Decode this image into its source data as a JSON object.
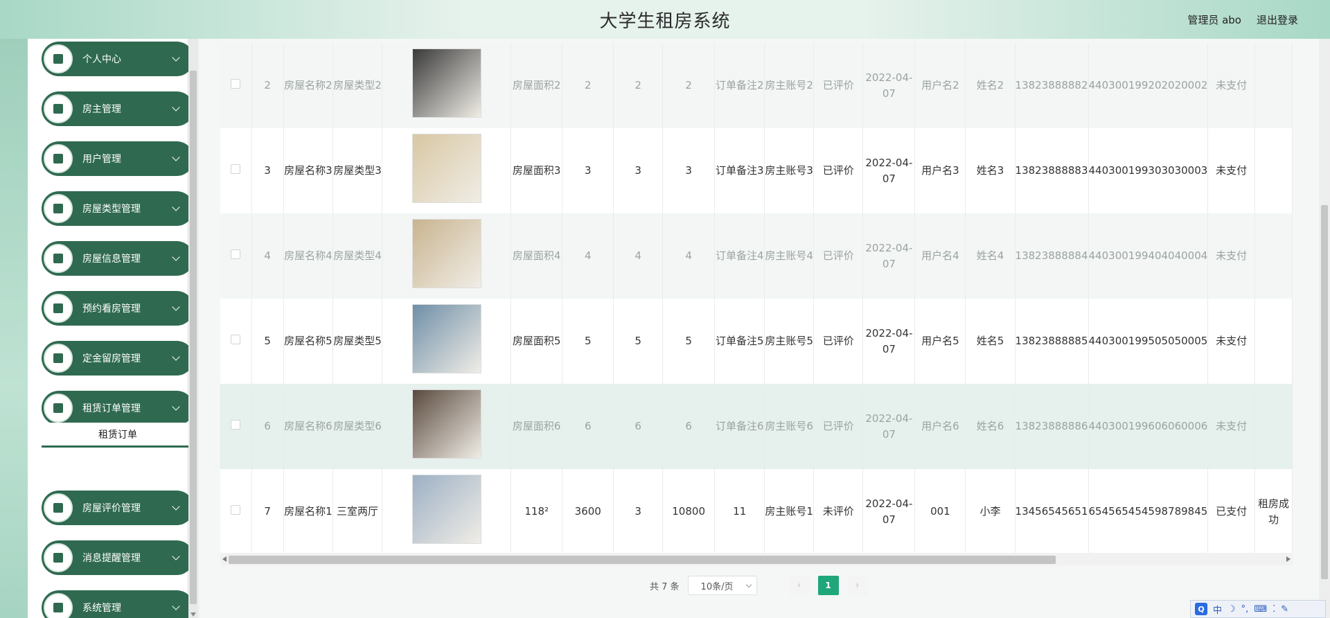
{
  "header": {
    "title": "大学生租房系统",
    "user_label": "管理员 abo",
    "logout_label": "退出登录"
  },
  "sidebar": {
    "items": [
      {
        "label": "个人中心",
        "icon": "user-icon"
      },
      {
        "label": "房主管理",
        "icon": "clipboard-icon"
      },
      {
        "label": "用户管理",
        "icon": "grid-icon"
      },
      {
        "label": "房屋类型管理",
        "icon": "list-icon"
      },
      {
        "label": "房屋信息管理",
        "icon": "briefcase-icon"
      },
      {
        "label": "预约看房管理",
        "icon": "grid-icon"
      },
      {
        "label": "定金留房管理",
        "icon": "clipboard-icon"
      },
      {
        "label": "租赁订单管理",
        "icon": "grid-icon"
      },
      {
        "label": "房屋评价管理",
        "icon": "grid-icon"
      },
      {
        "label": "消息提醒管理",
        "icon": "chat-icon"
      },
      {
        "label": "系统管理",
        "icon": "book-icon"
      }
    ],
    "submenu": {
      "label": "租赁订单"
    }
  },
  "table": {
    "rows": [
      {
        "idx": "2",
        "name": "房屋名称2",
        "type": "房屋类型2",
        "area": "房屋面积2",
        "c1": "2",
        "c2": "2",
        "c3": "2",
        "note": "订单备注2",
        "owner": "房主账号2",
        "review": "已评价",
        "date": "2022-04-07",
        "user": "用户名2",
        "realname": "姓名2",
        "phone": "13823888882",
        "idcard": "440300199202020002",
        "pay": "未支付",
        "extra": "",
        "img_color": "#3a3a3a"
      },
      {
        "idx": "3",
        "name": "房屋名称3",
        "type": "房屋类型3",
        "area": "房屋面积3",
        "c1": "3",
        "c2": "3",
        "c3": "3",
        "note": "订单备注3",
        "owner": "房主账号3",
        "review": "已评价",
        "date": "2022-04-07",
        "user": "用户名3",
        "realname": "姓名3",
        "phone": "13823888883",
        "idcard": "440300199303030003",
        "pay": "未支付",
        "extra": "",
        "img_color": "#d8c7a3"
      },
      {
        "idx": "4",
        "name": "房屋名称4",
        "type": "房屋类型4",
        "area": "房屋面积4",
        "c1": "4",
        "c2": "4",
        "c3": "4",
        "note": "订单备注4",
        "owner": "房主账号4",
        "review": "已评价",
        "date": "2022-04-07",
        "user": "用户名4",
        "realname": "姓名4",
        "phone": "13823888884",
        "idcard": "440300199404040004",
        "pay": "未支付",
        "extra": "",
        "img_color": "#c9b48f"
      },
      {
        "idx": "5",
        "name": "房屋名称5",
        "type": "房屋类型5",
        "area": "房屋面积5",
        "c1": "5",
        "c2": "5",
        "c3": "5",
        "note": "订单备注5",
        "owner": "房主账号5",
        "review": "已评价",
        "date": "2022-04-07",
        "user": "用户名5",
        "realname": "姓名5",
        "phone": "13823888885",
        "idcard": "440300199505050005",
        "pay": "未支付",
        "extra": "",
        "img_color": "#6f8fa8"
      },
      {
        "idx": "6",
        "name": "房屋名称6",
        "type": "房屋类型6",
        "area": "房屋面积6",
        "c1": "6",
        "c2": "6",
        "c3": "6",
        "note": "订单备注6",
        "owner": "房主账号6",
        "review": "已评价",
        "date": "2022-04-07",
        "user": "用户名6",
        "realname": "姓名6",
        "phone": "13823888886",
        "idcard": "440300199606060006",
        "pay": "未支付",
        "extra": "",
        "img_color": "#5a4a3e"
      },
      {
        "idx": "7",
        "name": "房屋名称1",
        "type": "三室两厅",
        "area": "118²",
        "c1": "3600",
        "c2": "3",
        "c3": "10800",
        "note": "11",
        "owner": "房主账号1",
        "review": "未评价",
        "date": "2022-04-07",
        "user": "001",
        "realname": "小李",
        "phone": "13456545651",
        "idcard": "654565454598789845",
        "pay": "已支付",
        "extra": "租房成功",
        "img_color": "#9db0c4"
      }
    ]
  },
  "pagination": {
    "total": "共 7 条",
    "page_size": "10条/页",
    "current_page": "1",
    "prev": "‹",
    "next": "›"
  },
  "ime": {
    "logo": "Q",
    "lang": "中",
    "moon": "☽",
    "punct": "°,",
    "kbd": "⌨",
    "sep": "⁚",
    "tools": "✎"
  },
  "colors": {
    "menu_bg": "#2f6a50",
    "accent": "#1fa67a",
    "header_gradient_edge": "#a8d8c6"
  }
}
